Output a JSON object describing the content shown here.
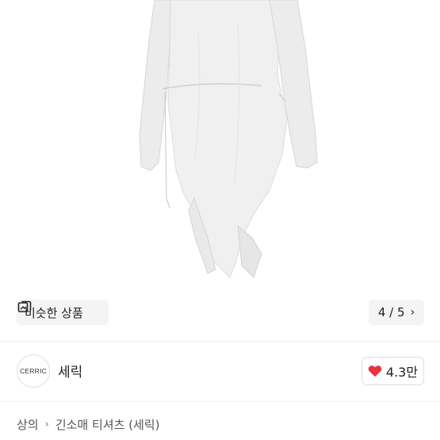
{
  "product_image": {
    "alt_icon": "garment-photo"
  },
  "similar_button": {
    "label": "비슷한 상품",
    "icon": "similar-products-icon"
  },
  "image_counter": {
    "text": "4 / 5",
    "icon": "chevron-right-icon"
  },
  "shop": {
    "logo_text": "CERRIC",
    "name": "세릭",
    "likes": "4.3만",
    "like_icon": "heart-icon",
    "like_color": "#e8323c"
  },
  "breadcrumb": {
    "items": [
      "상의",
      "긴소매 티셔츠 (세릭)"
    ],
    "separator_icon": "chevron-right-icon"
  }
}
